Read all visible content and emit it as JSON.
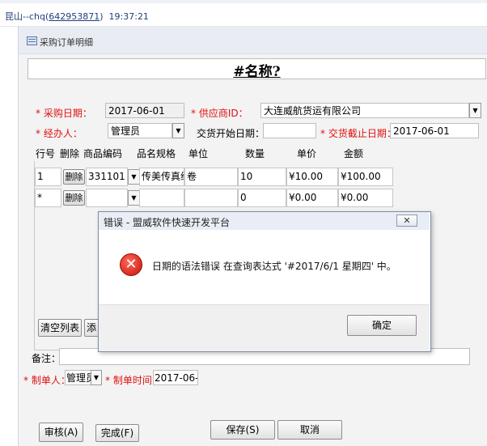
{
  "window": {
    "user_prefix": "昆山--chq(",
    "user_id": "642953871",
    "user_suffix": ")",
    "time": "19:37:21"
  },
  "form": {
    "title": "采购订单明细",
    "name_field": "#名称?",
    "purchase_date_label": "* 采购日期：",
    "purchase_date": "2017-06-01",
    "supplier_label": "* 供应商ID：",
    "supplier_value": "大连威航货运有限公司",
    "handler_label": "* 经办人：",
    "handler_value": "管理员",
    "delivery_start_label": "交货开始日期：",
    "delivery_start_value": "",
    "delivery_end_label": "* 交货截止日期：",
    "delivery_end_value": "2017-06-01",
    "columns": [
      "行号",
      "删除",
      "商品编码",
      "品名规格",
      "单位",
      "数量",
      "单价",
      "金额"
    ],
    "rows": [
      {
        "line": "1",
        "delete": "删除",
        "code": "331101",
        "spec": "传美传真纸",
        "unit": "卷",
        "qty": "10",
        "price": "¥10.00",
        "amount": "¥100.00"
      },
      {
        "line": "*",
        "delete": "删除",
        "code": "",
        "spec": "",
        "unit": "",
        "qty": "0",
        "price": "¥0.00",
        "amount": "¥0.00"
      }
    ],
    "clear_list_button": "清空列表",
    "add_button_partial": "添",
    "remark_label": "备注：",
    "remark_value": "",
    "creator_label": "* 制单人：",
    "creator_value": "管理员",
    "created_time_label": "* 制单时间：",
    "created_time_value": "2017-06-",
    "review_button": "审核(A)",
    "complete_button": "完成(F)",
    "save_button": "保存(S)",
    "cancel_button": "取消"
  },
  "dialog": {
    "title": "错误 - 盟威软件快速开发平台",
    "close_glyph": "✕",
    "message": "日期的语法错误 在查询表达式 '#2017/6/1 星期四' 中。",
    "ok_button": "确定"
  }
}
